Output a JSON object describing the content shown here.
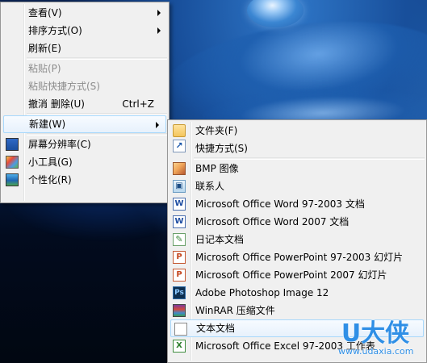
{
  "desktop": {
    "watermark_brand": "U大侠",
    "watermark_site": "www.udaxia.com"
  },
  "context_menu": {
    "items": [
      {
        "label": "查看(V)",
        "has_submenu": true
      },
      {
        "label": "排序方式(O)",
        "has_submenu": true
      },
      {
        "label": "刷新(E)"
      },
      {
        "label": "粘贴(P)",
        "disabled": true
      },
      {
        "label": "粘贴快捷方式(S)",
        "disabled": true
      },
      {
        "label": "撤消 删除(U)",
        "shortcut": "Ctrl+Z"
      },
      {
        "label": "新建(W)",
        "has_submenu": true,
        "highlighted": true
      },
      {
        "label": "屏幕分辨率(C)",
        "icon": "screen-resolution-icon"
      },
      {
        "label": "小工具(G)",
        "icon": "gadgets-icon"
      },
      {
        "label": "个性化(R)",
        "icon": "personalize-icon"
      }
    ]
  },
  "new_submenu": {
    "items": [
      {
        "label": "文件夹(F)",
        "icon": "folder-icon"
      },
      {
        "label": "快捷方式(S)",
        "icon": "shortcut-icon"
      },
      {
        "label": "BMP 图像",
        "icon": "bmp-image-icon"
      },
      {
        "label": "联系人",
        "icon": "contact-icon"
      },
      {
        "label": "Microsoft Office Word 97-2003 文档",
        "icon": "word-icon"
      },
      {
        "label": "Microsoft Office Word 2007 文档",
        "icon": "word-icon"
      },
      {
        "label": "日记本文档",
        "icon": "journal-icon"
      },
      {
        "label": "Microsoft Office PowerPoint 97-2003 幻灯片",
        "icon": "powerpoint-icon"
      },
      {
        "label": "Microsoft Office PowerPoint 2007 幻灯片",
        "icon": "powerpoint-icon"
      },
      {
        "label": "Adobe Photoshop Image 12",
        "icon": "photoshop-icon"
      },
      {
        "label": "WinRAR 压缩文件",
        "icon": "winrar-icon"
      },
      {
        "label": "文本文档",
        "icon": "text-document-icon",
        "highlighted": true
      },
      {
        "label": "Microsoft Office Excel 97-2003 工作表",
        "icon": "excel-icon"
      }
    ]
  },
  "colors": {
    "menu_bg": "#f0f0f0",
    "menu_border": "#979797",
    "highlight_border": "#a8d8fb",
    "disabled_text": "#8c8c8c",
    "desktop_dark": "#020b1e",
    "desktop_blue": "#1f5fa8"
  }
}
